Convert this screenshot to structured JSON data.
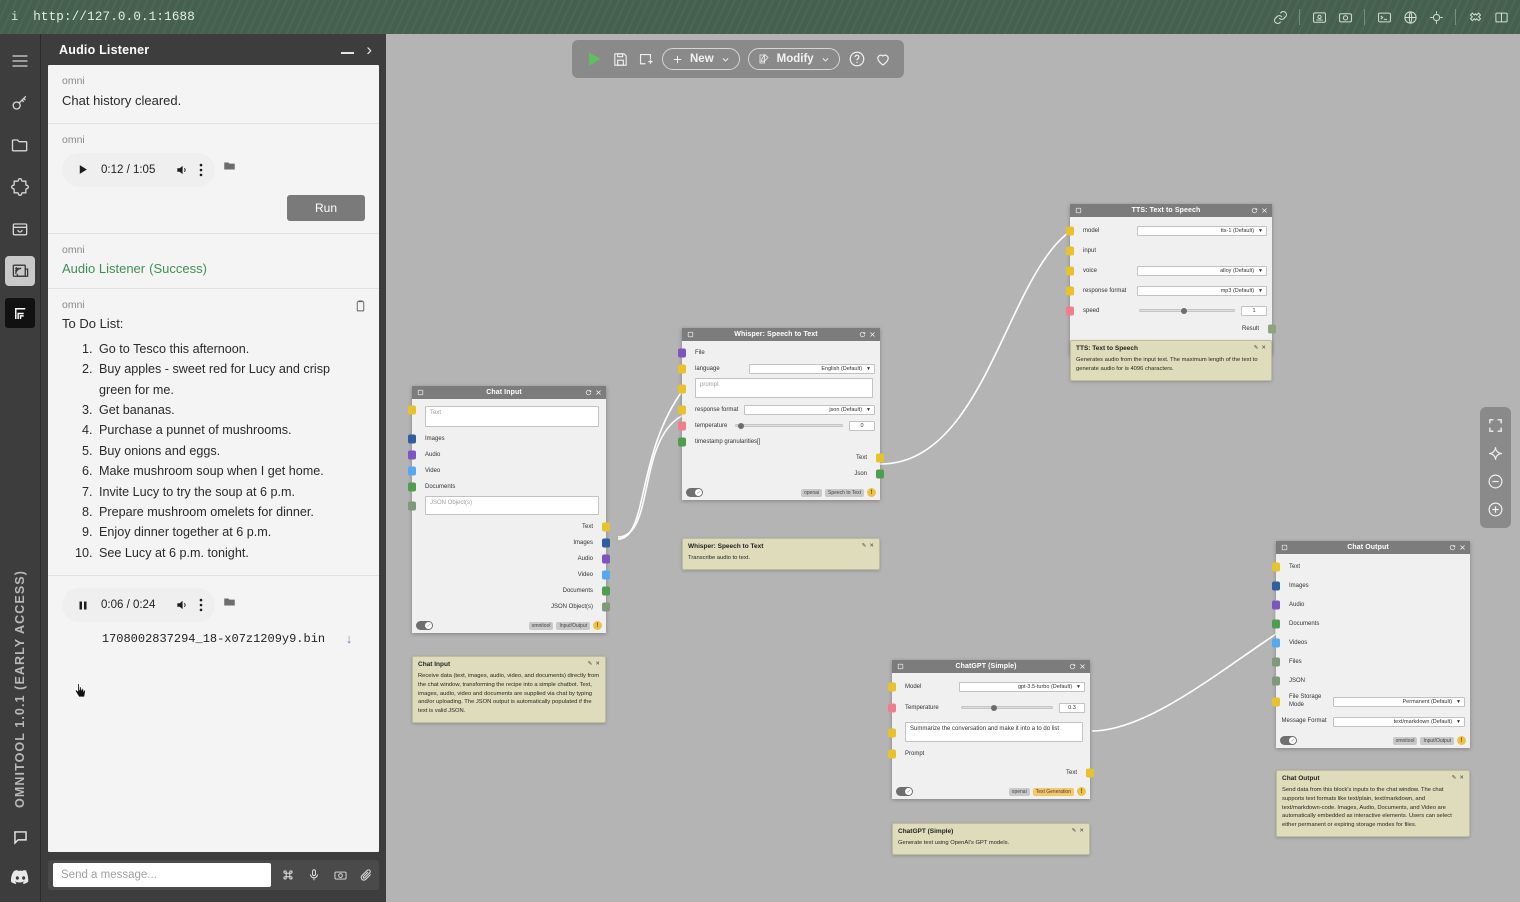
{
  "browser": {
    "info_icon": "info-icon",
    "url": "http://127.0.0.1:1688",
    "right_icons": [
      "link-icon",
      "image-capture-icon",
      "camera-icon",
      "terminal-icon",
      "globe-icon",
      "target-icon",
      "extension-icon",
      "panel-icon"
    ]
  },
  "rail": {
    "items": [
      {
        "name": "menu-icon",
        "glyph": "menu"
      },
      {
        "name": "key-icon",
        "glyph": "key"
      },
      {
        "name": "folder-icon",
        "glyph": "folder"
      },
      {
        "name": "puzzle-icon",
        "glyph": "puzzle"
      },
      {
        "name": "box-icon",
        "glyph": "box"
      },
      {
        "name": "recipes-icon",
        "glyph": "recipes"
      },
      {
        "name": "layers-icon",
        "glyph": "layers"
      }
    ],
    "version_label": "OMNITOOL  1.0.1  (EARLY ACCESS)",
    "bottom_icons": [
      "chat-bubble-icon",
      "discord-icon"
    ]
  },
  "chat": {
    "title": "Audio Listener",
    "minimize_label": "minimize",
    "expand_label": "expand",
    "messages": [
      {
        "author": "omni",
        "text": "Chat history cleared."
      },
      {
        "author": "omni",
        "player": {
          "time": "0:12 / 1:05",
          "progress": 33,
          "state": "play"
        },
        "run_label": "Run"
      },
      {
        "author": "omni",
        "status_name": "Audio Listener",
        "status_state": "(Success)"
      },
      {
        "author": "omni",
        "todo_title": "To Do List:",
        "todo": [
          "Go to Tesco this afternoon.",
          "Buy apples - sweet red for Lucy and crisp green for me.",
          "Get bananas.",
          "Purchase a punnet of mushrooms.",
          "Buy onions and eggs.",
          "Make mushroom soup when I get home.",
          "Invite Lucy to try the soup at 6 p.m.",
          "Prepare mushroom omelets for dinner.",
          "Enjoy dinner together at 6 p.m.",
          "See Lucy at 6 p.m. tonight."
        ]
      },
      {
        "player": {
          "time": "0:06 / 0:24",
          "progress": 28,
          "state": "pause"
        },
        "filename": "1708002837294_18-x07z1209y9.bin",
        "download_glyph": "↓"
      }
    ],
    "input_placeholder": "Send a message...",
    "input_value": "",
    "foot_icons": [
      "command-icon",
      "microphone-icon",
      "camera-icon",
      "attachment-icon"
    ]
  },
  "toolbar": {
    "run_label": "run-recipe",
    "save_label": "save-recipe",
    "add_label": "new-recipe",
    "new_label": "New",
    "modify_label": "Modify",
    "help_label": "help",
    "favorite_label": "favorite"
  },
  "side_controls": [
    "fit-screen-icon",
    "sparkle-icon",
    "zoom-out-icon",
    "zoom-in-icon"
  ],
  "nodes": [
    {
      "id": "chat-input",
      "title": "Chat Input",
      "inputs": [
        {
          "label": "",
          "type": "textarea",
          "placeholder": "Text",
          "color": "p-yellow"
        },
        {
          "label": "Images",
          "type": "port",
          "color": "p-blue"
        },
        {
          "label": "Audio",
          "type": "port",
          "color": "p-purple"
        },
        {
          "label": "Video",
          "type": "port",
          "color": "p-lblue"
        },
        {
          "label": "Documents",
          "type": "port",
          "color": "p-green"
        },
        {
          "label": "",
          "type": "textarea",
          "placeholder": "JSON Object(s)",
          "color": "p-gray-green"
        }
      ],
      "outputs": [
        {
          "label": "Text",
          "color": "p-yellow"
        },
        {
          "label": "Images",
          "color": "p-blue"
        },
        {
          "label": "Audio",
          "color": "p-purple"
        },
        {
          "label": "Video",
          "color": "p-lblue"
        },
        {
          "label": "Documents",
          "color": "p-green"
        },
        {
          "label": "JSON Object(s)",
          "color": "p-gray-green"
        }
      ],
      "tags": [
        "omnitool",
        "Input/Output"
      ],
      "note_title": "Chat Input",
      "note_text": "Receive data (text, images, audio, video, and documents) directly from the chat window, transforming the recipe into a simple chatbot. Text, images, audio, video and documents are supplied via chat by typing and/or uploading. The JSON output is automatically populated if the text is valid JSON."
    },
    {
      "id": "whisper",
      "title": "Whisper: Speech to Text",
      "inputs": [
        {
          "label": "File",
          "type": "port",
          "color": "p-purple"
        },
        {
          "label": "language",
          "type": "select",
          "value": "English (Default)",
          "color": "p-yellow"
        },
        {
          "label": "",
          "type": "textarea",
          "placeholder": "prompt",
          "color": "p-yellow"
        },
        {
          "label": "response format",
          "type": "select",
          "value": "json (Default)",
          "color": "p-yellow"
        },
        {
          "label": "temperature",
          "type": "slider",
          "value": "0",
          "knob": 3,
          "color": "p-pink"
        },
        {
          "label": "timestamp granularities[]",
          "type": "port",
          "color": "p-green"
        }
      ],
      "outputs": [
        {
          "label": "Text",
          "color": "p-yellow"
        },
        {
          "label": "Json",
          "color": "p-green"
        }
      ],
      "tags": [
        "openai",
        "Speech to Text"
      ],
      "note_title": "Whisper: Speech to Text",
      "note_text": "Transcribe audio to text."
    },
    {
      "id": "tts",
      "title": "TTS: Text to Speech",
      "inputs": [
        {
          "label": "model",
          "type": "select",
          "value": "tts-1 (Default)",
          "color": "p-yellow"
        },
        {
          "label": "input",
          "type": "port",
          "color": "p-yellow"
        },
        {
          "label": "voice",
          "type": "select",
          "value": "alloy (Default)",
          "color": "p-yellow"
        },
        {
          "label": "response format",
          "type": "select",
          "value": "mp3 (Default)",
          "color": "p-yellow"
        },
        {
          "label": "speed",
          "type": "slider",
          "value": "1",
          "knob": 45,
          "color": "p-pink"
        }
      ],
      "outputs": [
        {
          "label": "Result",
          "color": "p-olive"
        }
      ],
      "tags": [
        "openai",
        "Text to Speech"
      ],
      "note_title": "TTS: Text to Speech",
      "note_text": "Generates audio from the input text. The maximum length of the text to generate audio for is 4096 characters."
    },
    {
      "id": "chatgpt",
      "title": "ChatGPT (Simple)",
      "inputs": [
        {
          "label": "Model",
          "type": "select",
          "value": "gpt-3.5-turbo (Default)",
          "color": "p-yellow"
        },
        {
          "label": "Temperature",
          "type": "slider",
          "value": "0.3",
          "knob": 33,
          "color": "p-pink"
        },
        {
          "label": "",
          "type": "textarea",
          "placeholder": "Summarize the conversation and make it into a to do list",
          "filled": true,
          "color": "p-yellow"
        },
        {
          "label": "Prompt",
          "type": "port",
          "color": "p-yellow"
        }
      ],
      "outputs": [
        {
          "label": "Text",
          "color": "p-yellow"
        }
      ],
      "tags": [
        "openai",
        "Text Generation"
      ],
      "note_title": "ChatGPT (Simple)",
      "note_text": "Generate text using OpenAI's GPT models."
    },
    {
      "id": "chat-output",
      "title": "Chat Output",
      "inputs": [
        {
          "label": "Text",
          "type": "port",
          "color": "p-yellow"
        },
        {
          "label": "Images",
          "type": "port",
          "color": "p-blue"
        },
        {
          "label": "Audio",
          "type": "port",
          "color": "p-purple"
        },
        {
          "label": "Documents",
          "type": "port",
          "color": "p-green"
        },
        {
          "label": "Videos",
          "type": "port",
          "color": "p-lblue"
        },
        {
          "label": "Files",
          "type": "port",
          "color": "p-gray-green"
        },
        {
          "label": "JSON",
          "type": "port",
          "color": "p-gray-green"
        },
        {
          "label": "File Storage Mode",
          "type": "select",
          "value": "Permanent (Default)",
          "color": "p-yellow"
        },
        {
          "label": "Message Format",
          "type": "select",
          "value": "text/markdown (Default)",
          "color": "none"
        }
      ],
      "outputs": [],
      "tags": [
        "omnitool",
        "Input/Output"
      ],
      "note_title": "Chat Output",
      "note_text": "Send data from this block's inputs to the chat window. The chat supports text formats like text/plain, text/markdown, and text/markdown-code. Images, Audio, Documents, and Video are automatically embedded as interactive elements. Users can select either permanent or expiring storage modes for files."
    }
  ],
  "colors": {
    "chrome": "#46604f",
    "panel": "#3d3d3d",
    "canvas": "#b4b4b4",
    "accent_green": "#5cc15c",
    "success_text": "#3f8f55",
    "note_bg": "#dedcba"
  }
}
